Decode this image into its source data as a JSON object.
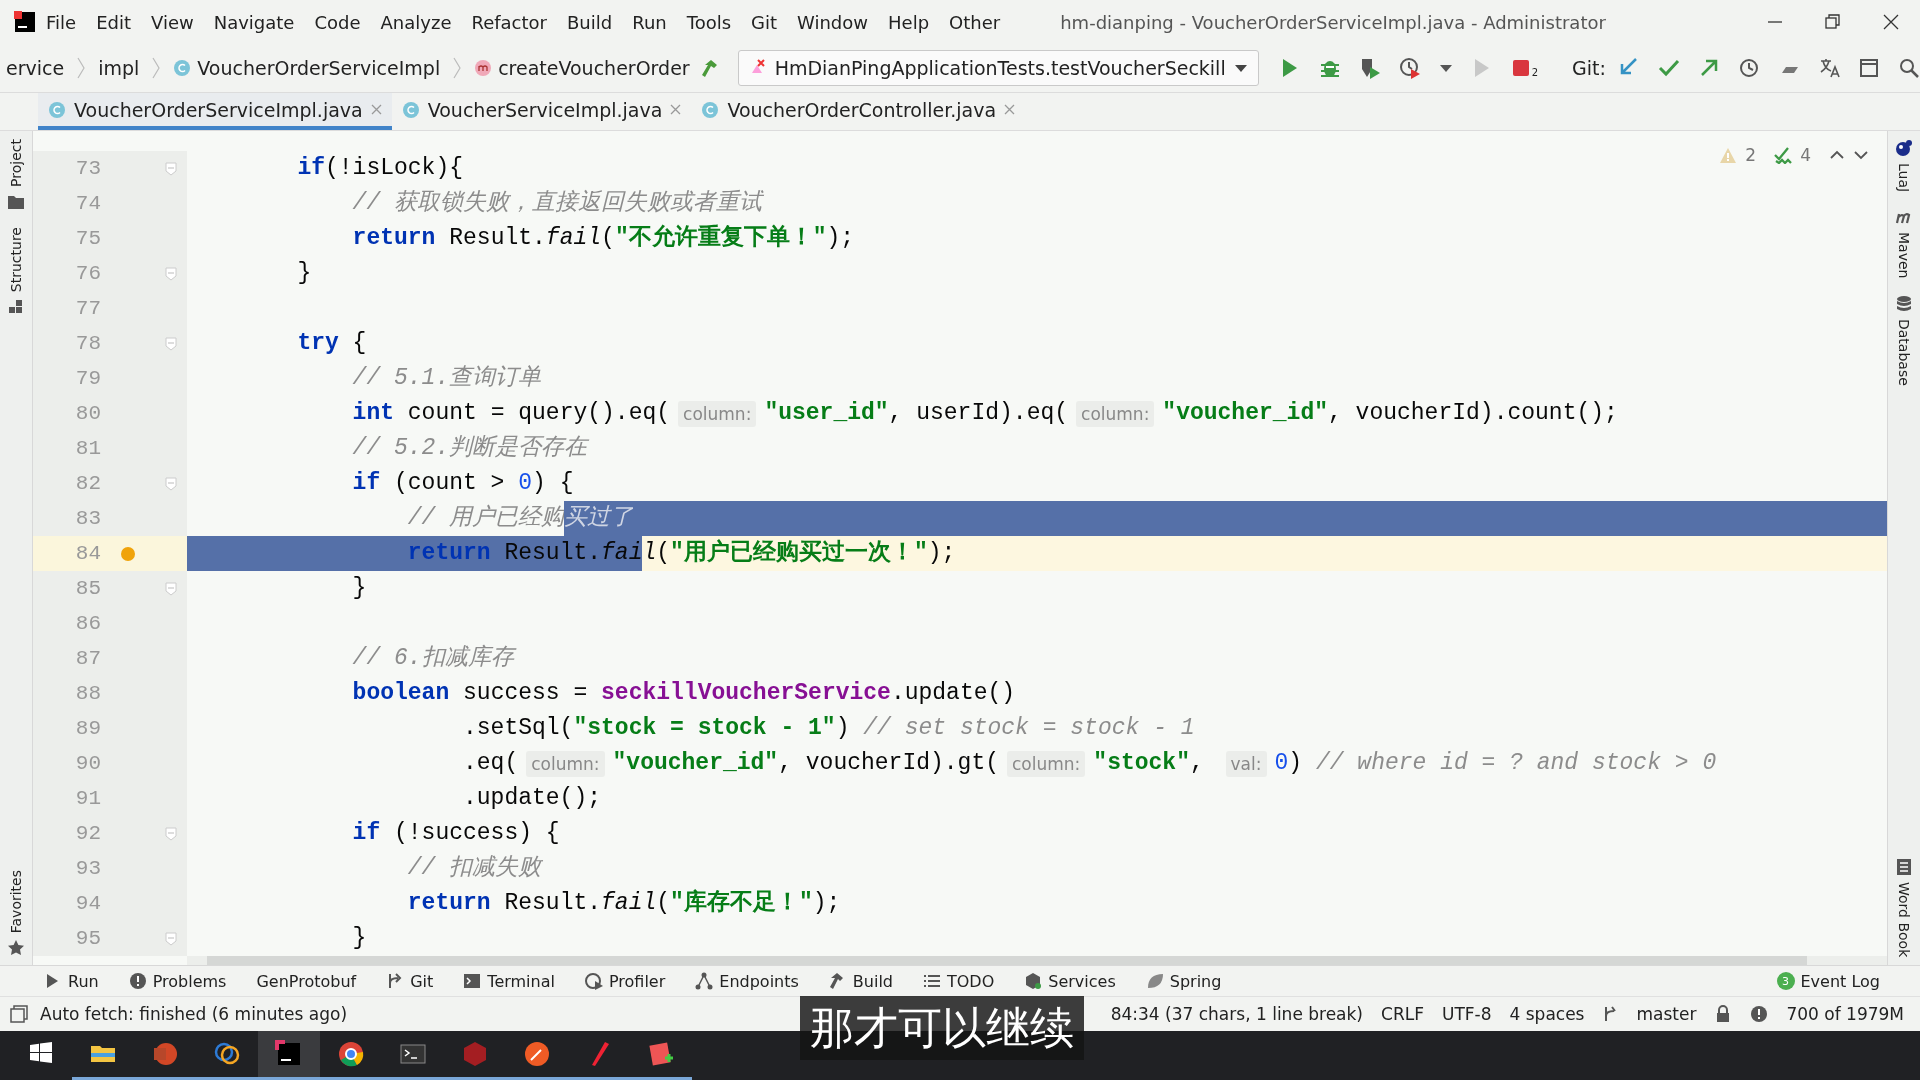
{
  "menu": [
    "File",
    "Edit",
    "View",
    "Navigate",
    "Code",
    "Analyze",
    "Refactor",
    "Build",
    "Run",
    "Tools",
    "Git",
    "Window",
    "Help",
    "Other"
  ],
  "window": {
    "title": "hm-dianping - VoucherOrderServiceImpl.java - Administrator"
  },
  "breadcrumbs": [
    {
      "label": "ervice",
      "kind": "folder"
    },
    {
      "label": "impl",
      "kind": "folder"
    },
    {
      "label": "VoucherOrderServiceImpl",
      "kind": "class"
    },
    {
      "label": "createVoucherOrder",
      "kind": "method"
    }
  ],
  "run_config": {
    "label": "HmDianPingApplicationTests.testVoucherSeckill"
  },
  "stop_badge": "2",
  "git_label": "Git:",
  "tabs": [
    {
      "label": "VoucherOrderServiceImpl.java",
      "selected": true
    },
    {
      "label": "VoucherServiceImpl.java",
      "selected": false
    },
    {
      "label": "VoucherOrderController.java",
      "selected": false
    }
  ],
  "left_stripe": [
    "Project",
    "Structure",
    "Favorites"
  ],
  "right_stripe": [
    "LuaJ",
    "Maven",
    "Database",
    "Word Book"
  ],
  "inspections": {
    "warnings": "2",
    "weak_warnings": "4"
  },
  "lines": [
    {
      "number": "73",
      "kind": "block",
      "fold": true,
      "current": false,
      "bulb": false,
      "tail": false,
      "segs": [
        {
          "kind": "kw",
          "text": "if"
        },
        {
          "kind": "plain",
          "text": "(!isLock){"
        }
      ],
      "children": [
        {
          "number": "74",
          "kind": "block",
          "fold": false,
          "current": false,
          "bulb": false,
          "tail": false,
          "segs": [
            {
              "kind": "comment",
              "text": "// 获取锁失败，直接返回失败或者重试"
            }
          ]
        },
        {
          "number": "75",
          "kind": "block",
          "fold": false,
          "current": false,
          "bulb": false,
          "tail": false,
          "segs": [
            {
              "kind": "kw",
              "text": "return"
            },
            {
              "kind": "plain",
              "text": " Result."
            },
            {
              "kind": "italic",
              "text": "fail"
            },
            {
              "kind": "plain",
              "text": "("
            },
            {
              "kind": "str",
              "text": "\"不允许重复下单！\""
            },
            {
              "kind": "plain",
              "text": ");"
            }
          ]
        }
      ]
    },
    {
      "number": "76",
      "kind": "block",
      "fold": true,
      "current": false,
      "bulb": false,
      "tail": false,
      "segs": [
        {
          "kind": "plain",
          "text": "}"
        }
      ]
    },
    {
      "number": "77",
      "kind": "block",
      "fold": false,
      "current": false,
      "bulb": false,
      "tail": false
    },
    {
      "number": "78",
      "kind": "block",
      "fold": true,
      "current": false,
      "bulb": false,
      "tail": false,
      "segs": [
        {
          "kind": "kw",
          "text": "try"
        },
        {
          "kind": "plain",
          "text": " {"
        }
      ],
      "children": [
        {
          "number": "79",
          "kind": "block",
          "fold": false,
          "current": false,
          "bulb": false,
          "tail": false,
          "segs": [
            {
              "kind": "comment",
              "text": "// 5.1.查询订单"
            }
          ]
        },
        {
          "number": "80",
          "kind": "block",
          "fold": false,
          "current": false,
          "bulb": false,
          "tail": false,
          "segs": [
            {
              "kind": "kw",
              "text": "int"
            },
            {
              "kind": "plain",
              "text": " count = query().eq("
            },
            {
              "kind": "hint",
              "text": "column:"
            },
            {
              "kind": "str",
              "text": "\"user_id\""
            },
            {
              "kind": "plain",
              "text": ", userId).eq("
            },
            {
              "kind": "hint",
              "text": "column:"
            },
            {
              "kind": "str",
              "text": "\"voucher_id\""
            },
            {
              "kind": "plain",
              "text": ", voucherId).count();"
            }
          ]
        },
        {
          "number": "81",
          "kind": "block",
          "fold": false,
          "current": false,
          "bulb": false,
          "tail": false,
          "segs": [
            {
              "kind": "comment",
              "text": "// 5.2.判断是否存在"
            }
          ]
        },
        {
          "number": "82",
          "kind": "block",
          "fold": true,
          "current": false,
          "bulb": false,
          "tail": false,
          "segs": [
            {
              "kind": "kw",
              "text": "if"
            },
            {
              "kind": "plain",
              "text": " (count > "
            },
            {
              "kind": "num",
              "text": "0"
            },
            {
              "kind": "plain",
              "text": ") {"
            }
          ],
          "children": [
            {
              "number": "83",
              "kind": "block",
              "fold": false,
              "current": false,
              "bulb": false,
              "tail": true,
              "segs": [
                {
                  "kind": "comment",
                  "text": "// 用户已经购",
                  "selected": false
                },
                {
                  "kind": "comment",
                  "text": "买过了",
                  "selected": true
                }
              ]
            },
            {
              "number": "84",
              "kind": "block",
              "fold": false,
              "current": true,
              "bulb": true,
              "tail": false,
              "lead_selected": true,
              "segs": [
                {
                  "kind": "kw",
                  "text": "return",
                  "selected": true
                },
                {
                  "kind": "plain",
                  "text": " Result.",
                  "selected": true
                },
                {
                  "kind": "italic",
                  "text": "fai",
                  "selected": true
                },
                {
                  "kind": "italic",
                  "text": "l",
                  "selected": false
                },
                {
                  "kind": "plain",
                  "text": "(",
                  "selected": false
                },
                {
                  "kind": "str",
                  "text": "\"用户已经购买过一次！\"",
                  "selected": false
                },
                {
                  "kind": "plain",
                  "text": ");",
                  "selected": false
                }
              ]
            }
          ]
        },
        {
          "number": "85",
          "kind": "block",
          "fold": true,
          "current": false,
          "bulb": false,
          "tail": false,
          "segs": [
            {
              "kind": "plain",
              "text": "}"
            }
          ]
        },
        {
          "number": "86",
          "kind": "block",
          "fold": false,
          "current": false,
          "bulb": false,
          "tail": false
        },
        {
          "number": "87",
          "kind": "block",
          "fold": false,
          "current": false,
          "bulb": false,
          "tail": false,
          "segs": [
            {
              "kind": "comment",
              "text": "// 6.扣减库存"
            }
          ]
        },
        {
          "number": "88",
          "kind": "block",
          "fold": false,
          "current": false,
          "bulb": false,
          "tail": false,
          "segs": [
            {
              "kind": "kw",
              "text": "boolean"
            },
            {
              "kind": "plain",
              "text": " success = "
            },
            {
              "kind": "field",
              "text": "seckillVoucherService"
            },
            {
              "kind": "plain",
              "text": ".update()"
            }
          ],
          "children": [
            {
              "number": "89",
              "kind": "continuation",
              "fold": false,
              "current": false,
              "bulb": false,
              "tail": false,
              "segs": [
                {
                  "kind": "plain",
                  "text": ".setSql("
                },
                {
                  "kind": "str",
                  "text": "\"stock = stock - 1\""
                },
                {
                  "kind": "plain",
                  "text": ") "
                },
                {
                  "kind": "comment",
                  "text": "// set stock = stock - 1"
                }
              ]
            },
            {
              "number": "90",
              "kind": "continuation",
              "fold": false,
              "current": false,
              "bulb": false,
              "tail": false,
              "segs": [
                {
                  "kind": "plain",
                  "text": ".eq("
                },
                {
                  "kind": "hint",
                  "text": "column:"
                },
                {
                  "kind": "str",
                  "text": "\"voucher_id\""
                },
                {
                  "kind": "plain",
                  "text": ", voucherId).gt("
                },
                {
                  "kind": "hint",
                  "text": "column:"
                },
                {
                  "kind": "str",
                  "text": "\"stock\""
                },
                {
                  "kind": "plain",
                  "text": ", "
                },
                {
                  "kind": "hint",
                  "text": "val:"
                },
                {
                  "kind": "num",
                  "text": "0"
                },
                {
                  "kind": "plain",
                  "text": ") "
                },
                {
                  "kind": "comment",
                  "text": "// where id = ? and stock > 0"
                }
              ]
            },
            {
              "number": "91",
              "kind": "continuation",
              "fold": false,
              "current": false,
              "bulb": false,
              "tail": false,
              "segs": [
                {
                  "kind": "plain",
                  "text": ".update();"
                }
              ]
            }
          ]
        },
        {
          "number": "92",
          "kind": "block",
          "fold": true,
          "current": false,
          "bulb": false,
          "tail": false,
          "segs": [
            {
              "kind": "kw",
              "text": "if"
            },
            {
              "kind": "plain",
              "text": " (!success) {"
            }
          ],
          "children": [
            {
              "number": "93",
              "kind": "block",
              "fold": false,
              "current": false,
              "bulb": false,
              "tail": false,
              "segs": [
                {
                  "kind": "comment",
                  "text": "// 扣减失败"
                }
              ]
            },
            {
              "number": "94",
              "kind": "block",
              "fold": false,
              "current": false,
              "bulb": false,
              "tail": false,
              "segs": [
                {
                  "kind": "kw",
                  "text": "return"
                },
                {
                  "kind": "plain",
                  "text": " Result."
                },
                {
                  "kind": "italic",
                  "text": "fail"
                },
                {
                  "kind": "plain",
                  "text": "("
                },
                {
                  "kind": "str",
                  "text": "\"库存不足！\""
                },
                {
                  "kind": "plain",
                  "text": ");"
                }
              ]
            }
          ]
        },
        {
          "number": "95",
          "kind": "block",
          "fold": true,
          "current": false,
          "bulb": false,
          "tail": false,
          "segs": [
            {
              "kind": "plain",
              "text": "}"
            }
          ]
        }
      ]
    }
  ],
  "tool_windows": [
    "Run",
    "Problems",
    "GenProtobuf",
    "Git",
    "Terminal",
    "Profiler",
    "Endpoints",
    "Build",
    "TODO",
    "Services",
    "Spring"
  ],
  "event_log": {
    "label": "Event Log",
    "count": "3"
  },
  "status_bar": {
    "message": "Auto fetch: finished (6 minutes ago)",
    "items": [
      "84:34 (37 chars, 1 line break)",
      "CRLF",
      "UTF-8",
      "4 spaces",
      "master"
    ],
    "memory": "700 of 1979M"
  },
  "subtitle": "那才可以继续"
}
